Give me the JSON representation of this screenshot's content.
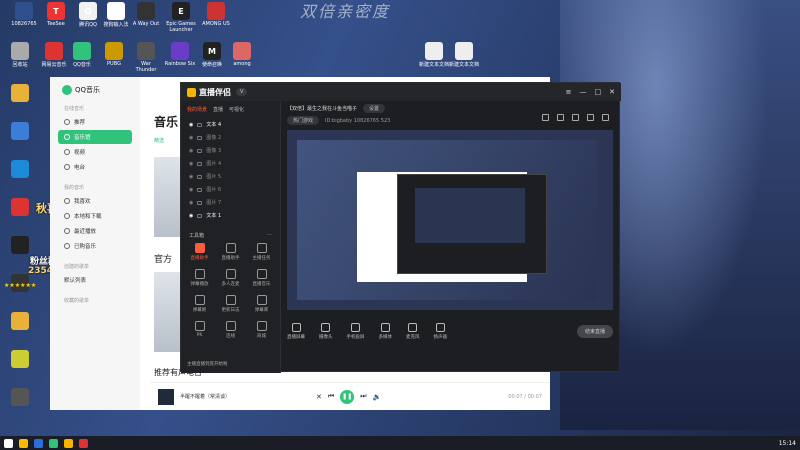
{
  "wallpaper": {
    "title_text": "双倍亲密度"
  },
  "desktop_icons": [
    {
      "label": "10826765",
      "color": "#2f4f8f",
      "glyph": ""
    },
    {
      "label": "TeeSee",
      "color": "#e33",
      "glyph": "T"
    },
    {
      "label": "腾讯QQ",
      "color": "#f2f2f2",
      "glyph": "Q"
    },
    {
      "label": "搜狗输入法",
      "color": "#fff",
      "glyph": "S"
    },
    {
      "label": "A Way Out",
      "color": "#333",
      "glyph": ""
    },
    {
      "label": "Epic Games Launcher",
      "color": "#222",
      "glyph": "E"
    },
    {
      "label": "AMONG US",
      "color": "#c33",
      "glyph": ""
    },
    {
      "label": "回收站",
      "color": "#aaa",
      "glyph": ""
    },
    {
      "label": "网易云音乐",
      "color": "#d33",
      "glyph": ""
    },
    {
      "label": "QQ音乐",
      "color": "#31c27c",
      "glyph": ""
    },
    {
      "label": "PUBG",
      "color": "#c90",
      "glyph": ""
    },
    {
      "label": "War Thunder",
      "color": "#555",
      "glyph": ""
    },
    {
      "label": "Rainbow Six",
      "color": "#6a3cc7",
      "glyph": ""
    },
    {
      "label": "使命召唤",
      "color": "#222",
      "glyph": "M"
    },
    {
      "label": "among",
      "color": "#d66",
      "glyph": ""
    },
    {
      "label": "新建文本文档",
      "color": "#eee",
      "glyph": ""
    },
    {
      "label": "新建文本文档",
      "color": "#eee",
      "glyph": ""
    }
  ],
  "overlays": {
    "nick": "秋喜",
    "id_line": "2354550502",
    "fans": "粉丝群",
    "stars": "★★★★★★"
  },
  "qqmusic": {
    "app_name": "QQ音乐",
    "group_online": "在线音乐",
    "nav": [
      "推荐",
      "音乐馆",
      "视频",
      "电台"
    ],
    "active_nav": 1,
    "group_mine": "我的音乐",
    "nav_mine": [
      "我喜欢",
      "本地和下载",
      "最近播放",
      "已购音乐"
    ],
    "group_created": "创建的歌单",
    "created_item": "默认列表",
    "group_fav": "收藏的歌单",
    "heading1": "音乐",
    "tab": "精选",
    "heading2": "官方",
    "heading3": "推荐有声电台",
    "player": {
      "song": "半醒不醒着（常清谈）",
      "time": "00:07 / 00:07"
    }
  },
  "streamer": {
    "brand": "直播伴侣",
    "room_title": "【双倍】最生之我在斗鱼当喵子",
    "room_pill": "设置",
    "room_tag": "热门游戏",
    "room_sub": "ID:bigbaby  10826765  523",
    "tabs": [
      "我的场景",
      "直播",
      "可视化"
    ],
    "scenes": [
      "文本 4",
      "图像 2",
      "图像 3",
      "图片 4",
      "图片 5",
      "图片 6",
      "图片 7",
      "文本 1"
    ],
    "tools_title": "工具箱",
    "tools": [
      "直播助手",
      "直播助手",
      "主播任务",
      "弹幕播放",
      "多人连麦",
      "直播音乐",
      "弹幕姬",
      "更新日志",
      "弹幕库",
      "PK",
      "连线",
      "商城"
    ],
    "footer": "主播直播到底开始啦",
    "bottom_buttons": [
      "直播屏幕",
      "摄像头",
      "手机投屏",
      "多媒体",
      "麦克风",
      "扬声器"
    ],
    "go_live": "结束直播"
  },
  "taskbar": {
    "time": "15:14"
  }
}
